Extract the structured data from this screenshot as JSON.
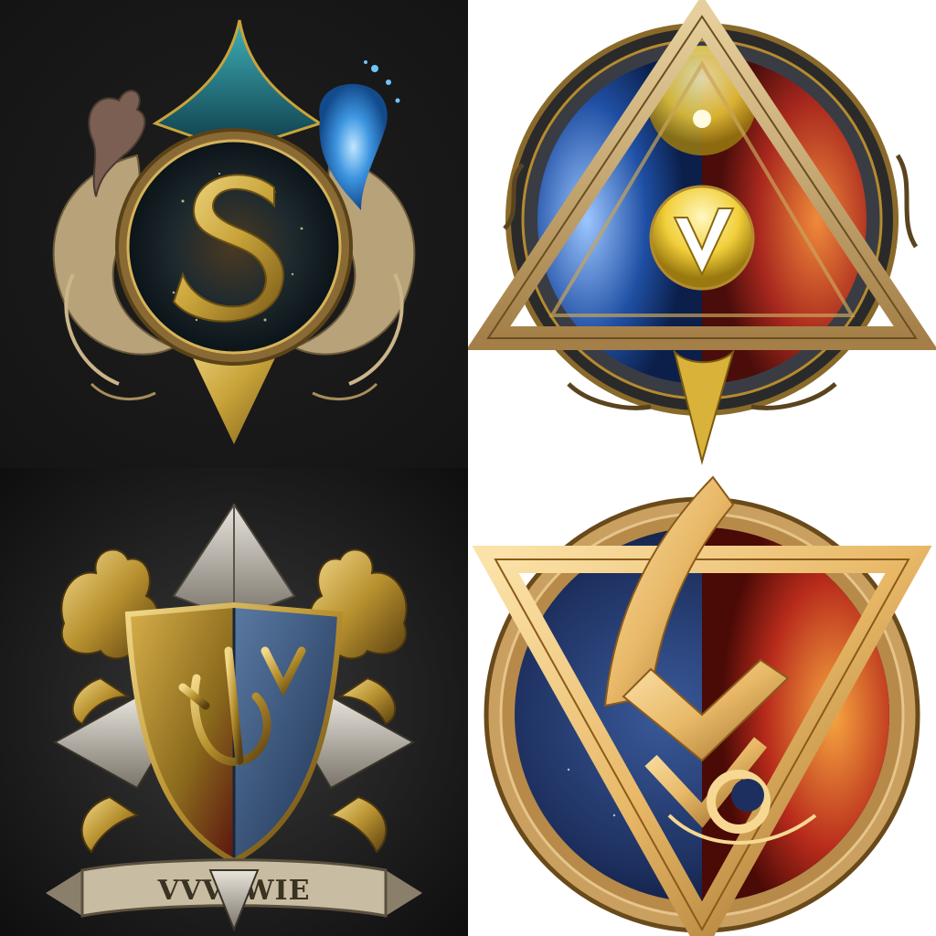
{
  "grid": {
    "columns": 2,
    "rows": 2
  },
  "tiles": [
    {
      "id": "tile-1",
      "background": "#161616",
      "accent": "#c9a43a",
      "glow": "#2f8bd8",
      "letter": "S"
    },
    {
      "id": "tile-2",
      "background": "#ffffff",
      "accent": "#b58b2e",
      "left_color": "#1f4fa3",
      "right_color": "#a8281e",
      "center_color": "#f2cf3a"
    },
    {
      "id": "tile-3",
      "background": "#1c1c1c",
      "accent": "#b8912f",
      "left_color": "#8c1f1a",
      "right_color": "#2c4e78",
      "banner_text": "VVVAWIE"
    },
    {
      "id": "tile-4",
      "background": "#ffffff",
      "accent": "#e8b867",
      "left_color": "#1d2f5e",
      "right_color": "#b82b1b"
    }
  ]
}
